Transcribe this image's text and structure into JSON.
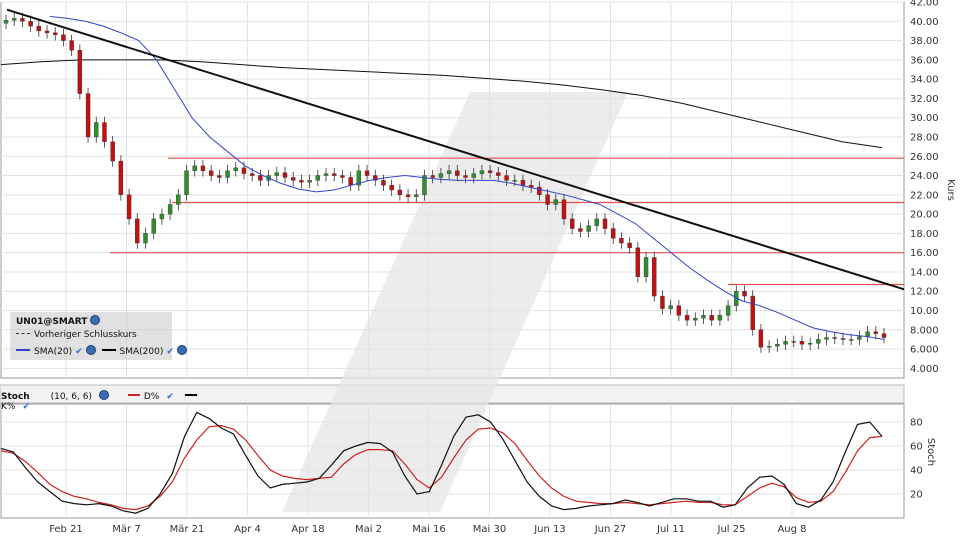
{
  "chart_data": [
    {
      "type": "candlestick",
      "symbol_label": "UN01@SMART",
      "ylabel": "Kurs",
      "ylim": [
        3,
        42
      ],
      "yticks": [
        "4.000",
        "6.000",
        "8.000",
        "10.00",
        "12.00",
        "14.00",
        "16.00",
        "18.00",
        "20.00",
        "22.00",
        "24.00",
        "26.00",
        "28.00",
        "30.00",
        "32.00",
        "34.00",
        "36.00",
        "38.00",
        "40.00",
        "42.00"
      ],
      "x_tick_labels": [
        "Feb 21",
        "Mär 7",
        "Mär 21",
        "Apr 4",
        "Apr 18",
        "Mai 2",
        "Mai 16",
        "Mai 30",
        "Jun 13",
        "Jun 27",
        "Jul 11",
        "Jul 25",
        "Aug 8"
      ],
      "grid": true,
      "legend": {
        "placement": "bottom-left",
        "items": [
          "Vorheriger Schlusskurs",
          "SMA(20)",
          "SMA(200)"
        ]
      },
      "candles_close": [
        40.1,
        40.3,
        40.0,
        39.5,
        39.0,
        38.8,
        38.6,
        38.0,
        37.0,
        32.5,
        28.0,
        29.5,
        27.5,
        25.5,
        22.0,
        19.5,
        17.0,
        18.0,
        19.5,
        20.0,
        21.0,
        22.0,
        24.5,
        25.0,
        24.5,
        24.0,
        23.8,
        24.5,
        24.8,
        24.2,
        24.0,
        23.5,
        24.0,
        24.3,
        23.8,
        23.5,
        23.3,
        23.5,
        24.0,
        24.2,
        24.0,
        23.8,
        23.0,
        24.5,
        24.0,
        23.5,
        23.0,
        22.5,
        22.0,
        21.8,
        22.0,
        24.0,
        23.8,
        24.2,
        24.5,
        24.0,
        23.8,
        24.2,
        24.5,
        24.3,
        24.0,
        23.5,
        23.5,
        23.0,
        22.8,
        22.0,
        21.0,
        21.5,
        19.5,
        18.5,
        18.2,
        18.8,
        19.5,
        18.5,
        17.5,
        17.0,
        16.5,
        13.5,
        15.5,
        11.5,
        10.2,
        10.5,
        9.5,
        9.0,
        9.2,
        9.5,
        9.0,
        9.5,
        10.5,
        12.0,
        11.5,
        8.0,
        6.2,
        6.3,
        6.5,
        6.8,
        6.8,
        6.5,
        6.6,
        7.0,
        7.2,
        7.1,
        7.0,
        7.0,
        7.3,
        7.8,
        7.6,
        7.2
      ],
      "sma20": [
        40.5,
        40.3,
        40.0,
        39.5,
        38.8,
        38.0,
        36.0,
        33.0,
        30.0,
        28.0,
        26.5,
        25.0,
        24.0,
        23.2,
        22.6,
        22.3,
        22.5,
        23.0,
        23.5,
        23.8,
        24.0,
        23.8,
        23.6,
        23.5,
        23.5,
        23.5,
        23.2,
        22.8,
        22.4,
        22.0,
        21.5,
        21.0,
        20.0,
        19.0,
        17.5,
        16.0,
        14.5,
        13.2,
        12.0,
        11.0,
        10.5,
        9.8,
        9.0,
        8.2,
        7.8,
        7.5,
        7.3,
        7.0
      ],
      "sma200": [
        35.5,
        35.8,
        36.0,
        36.0,
        36.0,
        35.8,
        35.5,
        35.2,
        35.0,
        34.8,
        34.6,
        34.4,
        34.1,
        33.8,
        33.4,
        32.9,
        32.3,
        31.5,
        30.5,
        29.5,
        28.5,
        27.5,
        26.9
      ],
      "trendline": [
        [
          0,
          41.2
        ],
        [
          1,
          12.2
        ]
      ],
      "horizontal_levels": [
        25.8,
        21.2,
        16.0,
        12.7
      ]
    },
    {
      "type": "line",
      "title": "Stoch",
      "params": "(10, 6, 6)",
      "ylabel": "Stoch",
      "ylim": [
        0,
        95
      ],
      "yticks": [
        "20",
        "40",
        "60",
        "80"
      ],
      "series": [
        {
          "name": "D%",
          "values": [
            56,
            54,
            47,
            38,
            28,
            22,
            18,
            16,
            13,
            11,
            8,
            7,
            10,
            18,
            30,
            50,
            65,
            76,
            77,
            74,
            65,
            52,
            40,
            35,
            33,
            32,
            33,
            34,
            45,
            53,
            57,
            57,
            56,
            45,
            32,
            25,
            34,
            50,
            65,
            74,
            75,
            71,
            62,
            48,
            35,
            25,
            18,
            14,
            13,
            12,
            12,
            13,
            12,
            11,
            12,
            13,
            14,
            13,
            13,
            11,
            11,
            18,
            25,
            29,
            26,
            17,
            13,
            14,
            22,
            38,
            56,
            67,
            68
          ]
        },
        {
          "name": "K%",
          "values": [
            58,
            55,
            42,
            30,
            22,
            14,
            12,
            11,
            12,
            10,
            6,
            4,
            8,
            20,
            37,
            68,
            88,
            83,
            75,
            70,
            52,
            35,
            25,
            28,
            29,
            30,
            33,
            44,
            56,
            60,
            63,
            62,
            55,
            35,
            20,
            22,
            44,
            68,
            84,
            86,
            80,
            66,
            48,
            30,
            18,
            10,
            7,
            8,
            10,
            11,
            12,
            15,
            13,
            10,
            13,
            16,
            16,
            14,
            14,
            9,
            11,
            25,
            34,
            35,
            28,
            12,
            9,
            15,
            30,
            55,
            78,
            80,
            68
          ]
        }
      ]
    }
  ],
  "colors": {
    "up": "#2f8f2f",
    "down": "#c41010",
    "sma20": "#3344cc",
    "sma200": "#111111",
    "levels": "#e05050",
    "d_line": "#d02020",
    "k_line": "#111111",
    "legend_bg": "#c8c8c8"
  },
  "icons": [
    "globe-icon",
    "check-icon"
  ],
  "stoch_labels": {
    "name": "Stoch",
    "params": "(10, 6, 6)",
    "d": "D%",
    "k": "K%"
  },
  "legend_labels": {
    "symbol": "UN01@SMART",
    "prev": "Vorheriger Schlusskurs",
    "sma20": "SMA(20)",
    "sma200": "SMA(200)"
  }
}
